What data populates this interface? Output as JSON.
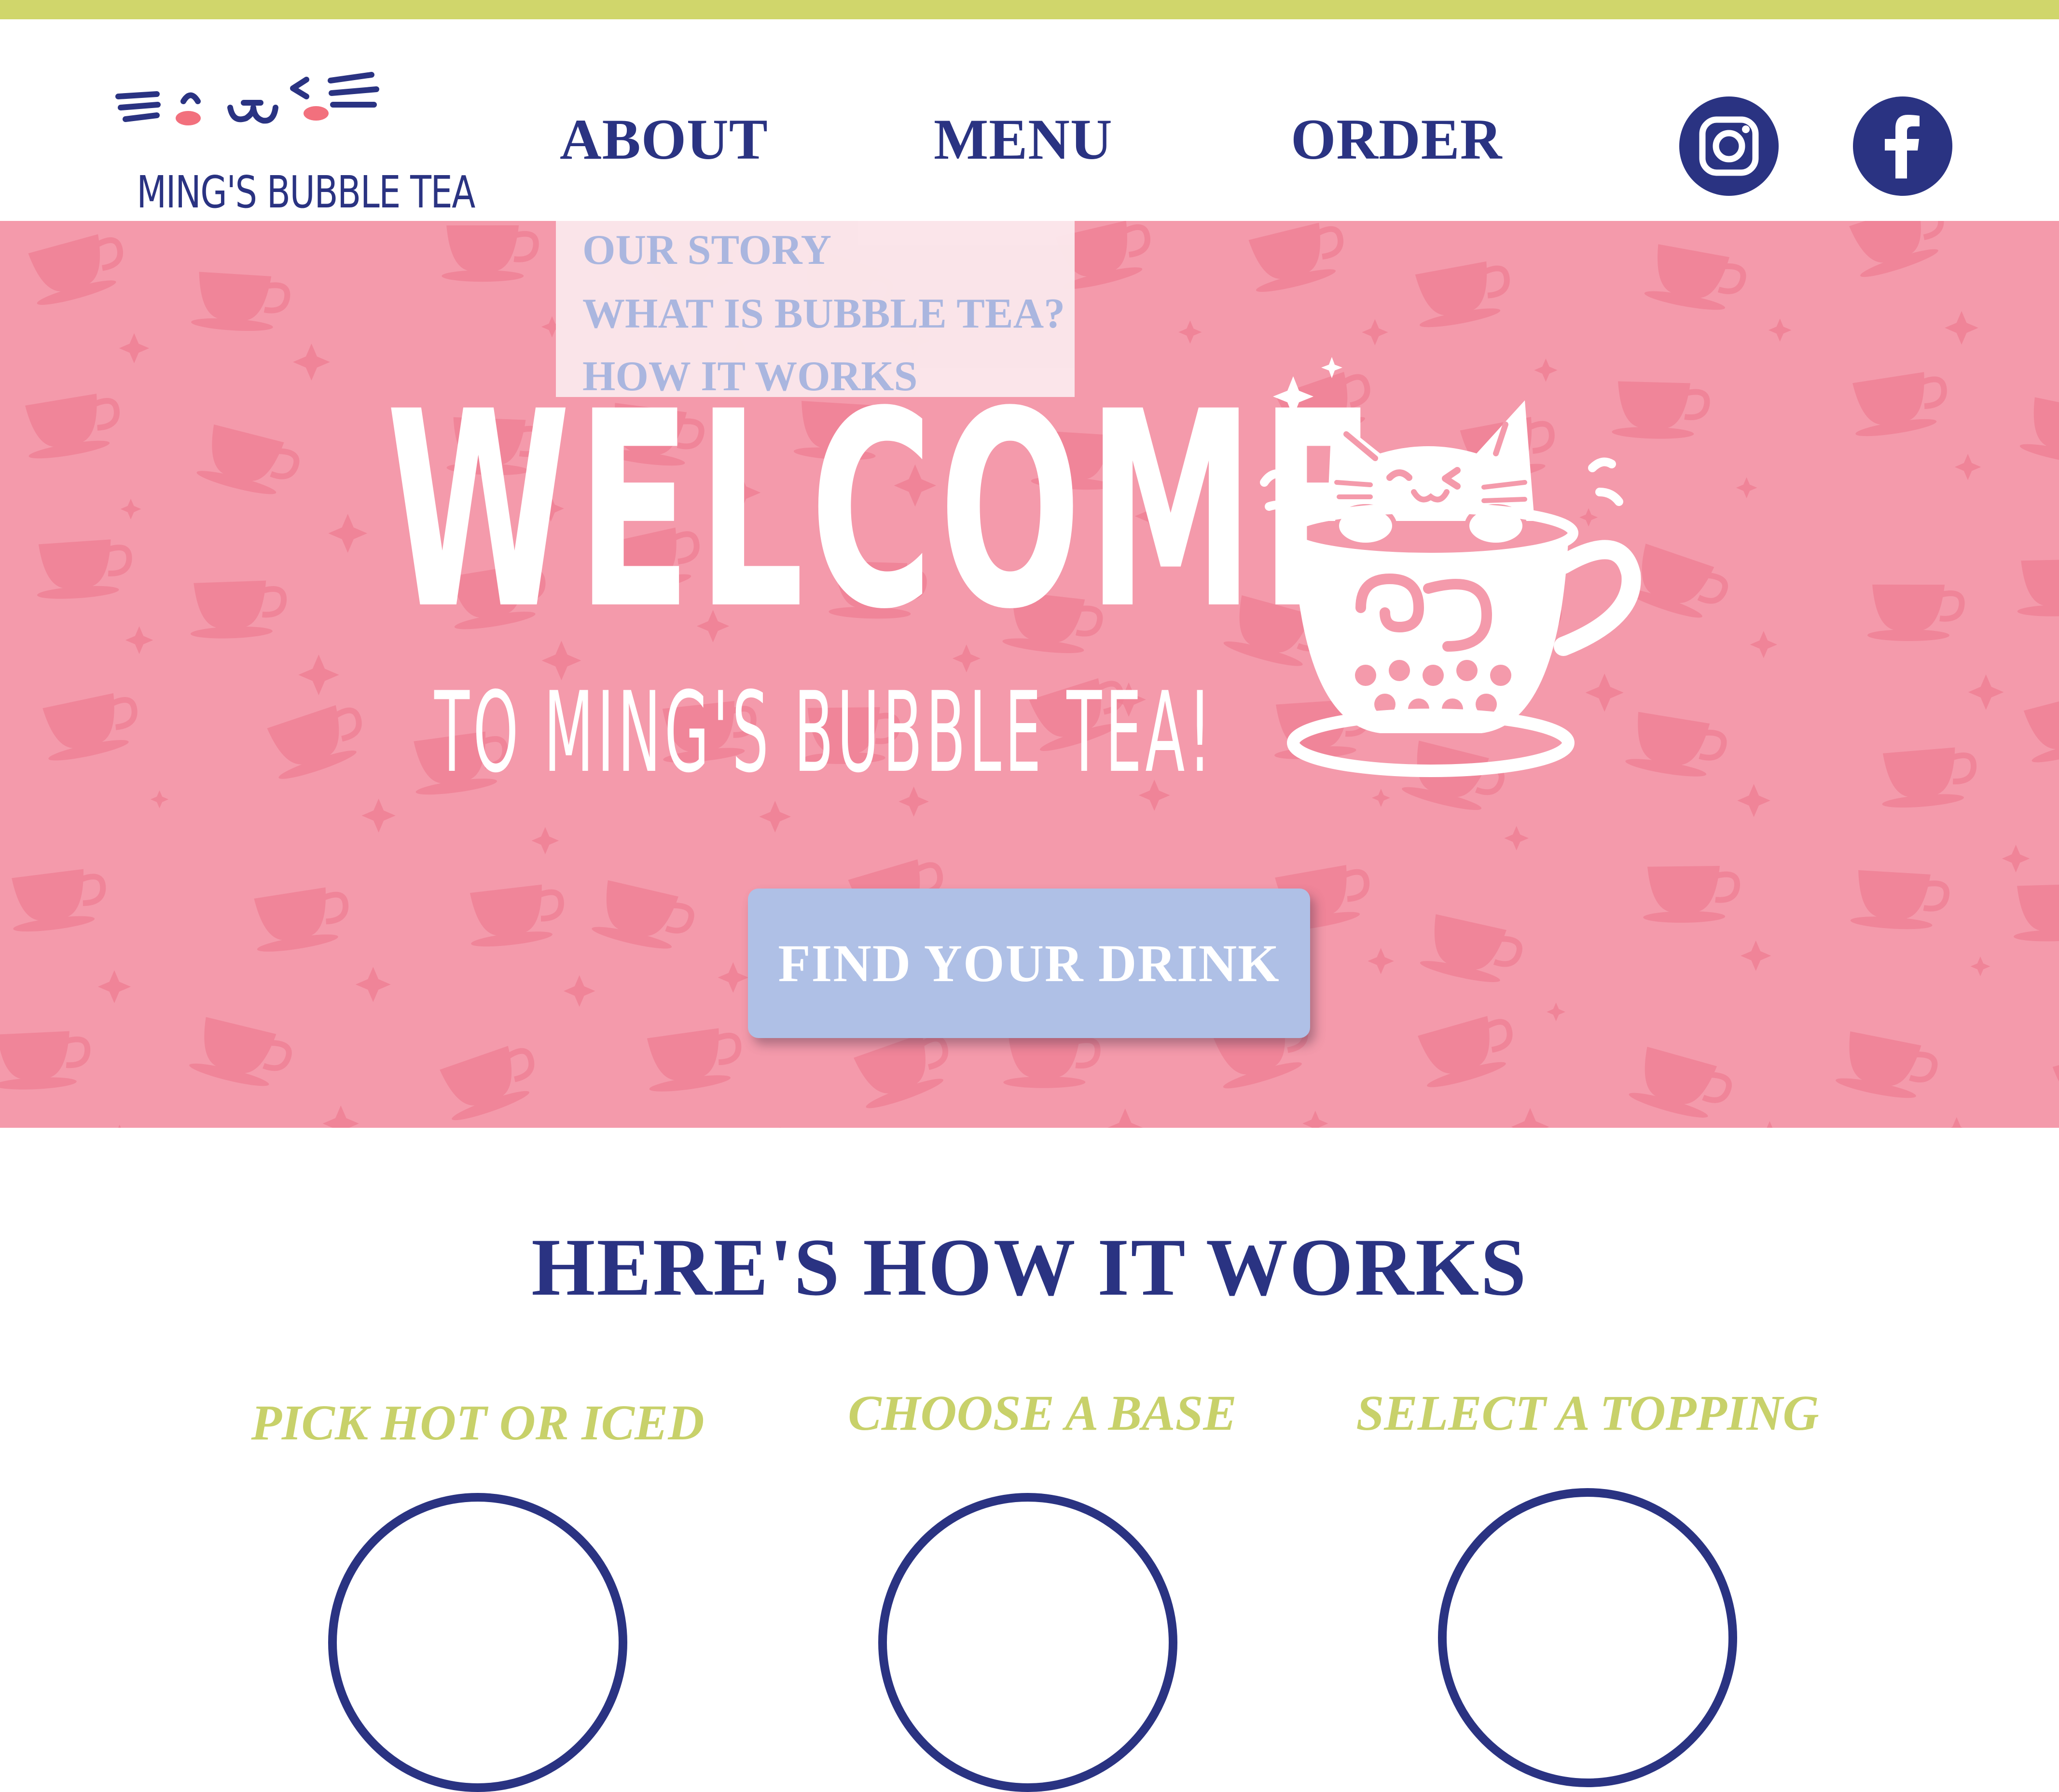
{
  "colors": {
    "accent_green": "#d0d66b",
    "navy": "#2a3382",
    "hero_pink": "#f49aab",
    "pattern_pink": "#ef7e93",
    "periwinkle": "#afc0e6",
    "dropdown_text": "#a7b8e2",
    "white": "#ffffff",
    "cheek_pink": "#f2707d"
  },
  "header": {
    "logo": {
      "text": "MING'S BUBBLE TEA",
      "icon": "cat-face-logo-icon"
    },
    "nav": [
      {
        "label": "ABOUT"
      },
      {
        "label": "MENU"
      },
      {
        "label": "ORDER"
      }
    ],
    "social": [
      {
        "icon": "instagram-icon"
      },
      {
        "icon": "facebook-icon"
      }
    ]
  },
  "about_dropdown": {
    "items": [
      {
        "label": "OUR STORY"
      },
      {
        "label": "WHAT IS BUBBLE TEA?"
      },
      {
        "label": "HOW IT WORKS"
      }
    ]
  },
  "hero": {
    "title": "WELCOME",
    "subtitle": "TO MING'S BUBBLE TEA!",
    "illustration": "cat-in-teacup-icon",
    "cta_label": "FIND YOUR DRINK"
  },
  "how_it_works": {
    "title": "HERE'S HOW IT WORKS",
    "steps": [
      {
        "label": "PICK HOT OR ICED"
      },
      {
        "label": "CHOOSE A BASE"
      },
      {
        "label": "SELECT A TOPPING"
      }
    ]
  }
}
